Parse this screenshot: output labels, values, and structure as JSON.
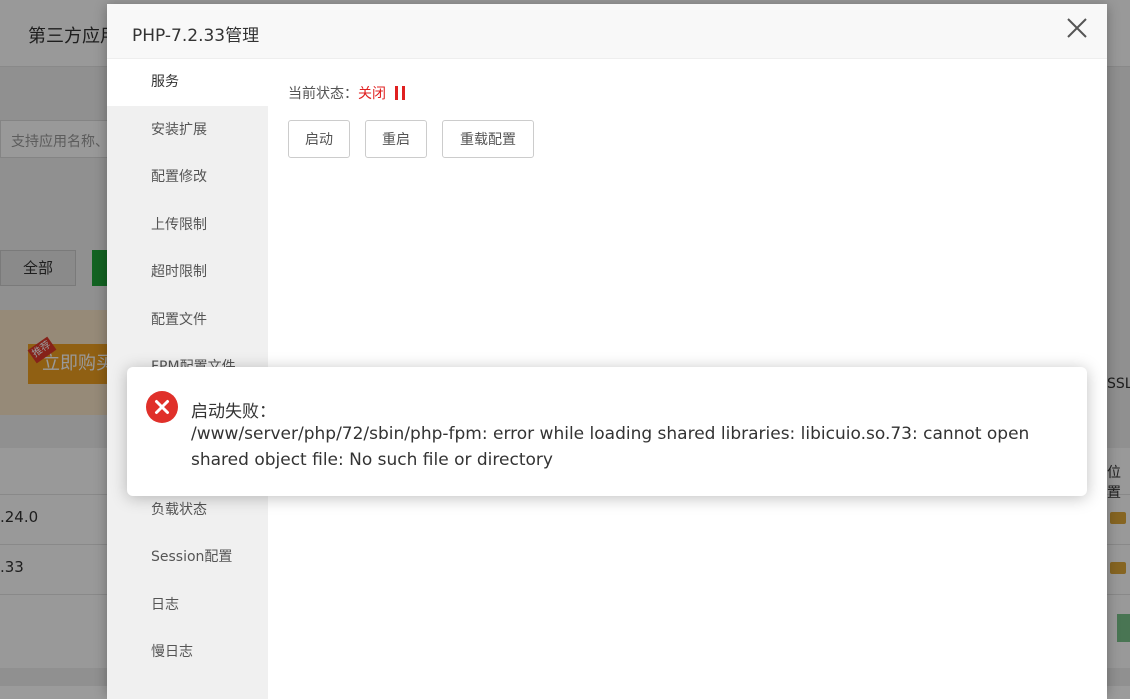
{
  "background": {
    "page_title": "第三方应用",
    "search_placeholder": "支持应用名称、",
    "filter_all": "全部",
    "buy_banner": "立即购买",
    "buy_tag": "推荐",
    "rows": [
      ".24.0",
      ".33"
    ],
    "right_label_1": "SSL",
    "right_label_2": "位置"
  },
  "modal": {
    "title": "PHP-7.2.33管理",
    "sidebar_items": [
      "服务",
      "安装扩展",
      "配置修改",
      "上传限制",
      "超时限制",
      "配置文件",
      "FPM配置文件",
      "",
      "",
      "负载状态",
      "Session配置",
      "日志",
      "慢日志"
    ],
    "status": {
      "label": "当前状态：",
      "value": "关闭"
    },
    "buttons": {
      "start": "启动",
      "restart": "重启",
      "reload": "重载配置"
    }
  },
  "toast": {
    "title": "启动失败：",
    "message": "/www/server/php/72/sbin/php-fpm: error while loading shared libraries: libicuio.so.73: cannot open shared object file: No such file or directory"
  },
  "colors": {
    "error_red": "#e02020",
    "toast_icon_red": "#e0302a",
    "brand_green": "#20a53a"
  }
}
